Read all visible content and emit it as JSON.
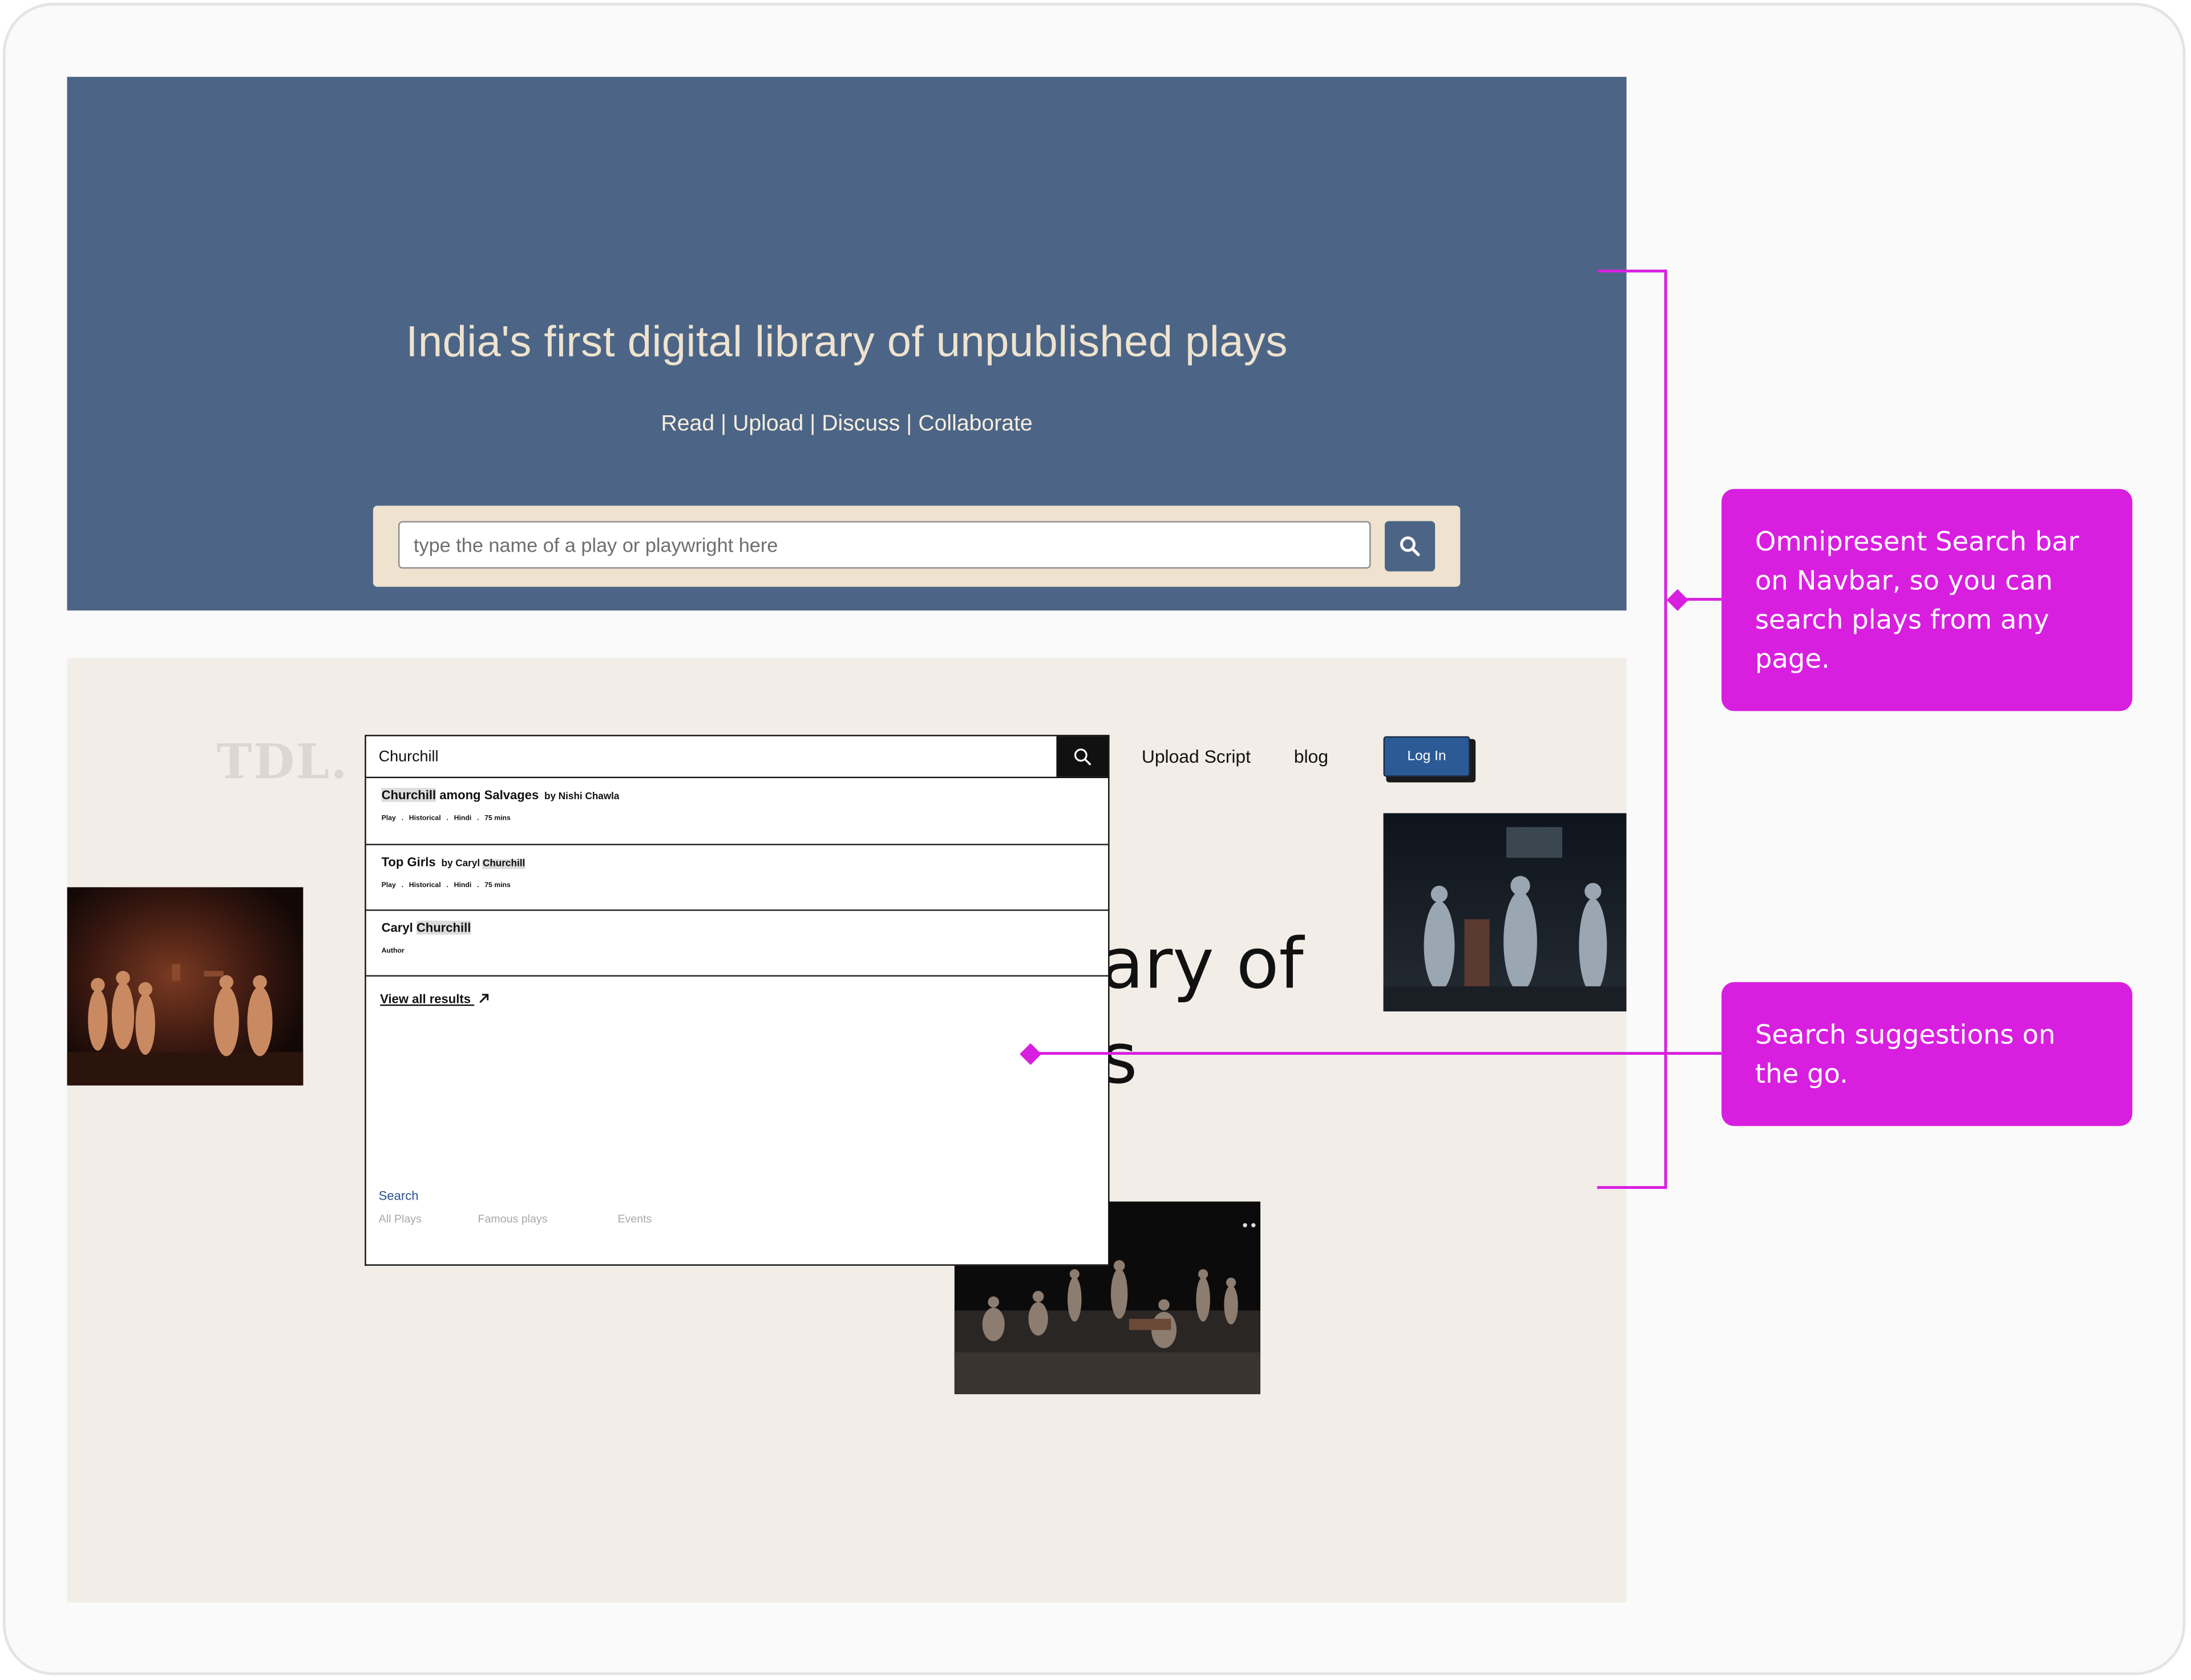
{
  "hero": {
    "title": "India's first digital library of unpublished plays",
    "subtitle": "Read | Upload | Discuss | Collaborate",
    "search_placeholder": "type the name of a play or playwright here",
    "bg_color": "#4c6586",
    "search_bg_color": "#efe3cf"
  },
  "navbar": {
    "logo": "TDL.",
    "search_value": "Churchill",
    "upload_label": "Upload Script",
    "blog_label": "blog",
    "login_label": "Log In"
  },
  "hero2": {
    "text_line1": "ary of",
    "text_line2": "s"
  },
  "suggestions": {
    "items": [
      {
        "title_highlight": "Churchill",
        "title_rest": " among Salvages",
        "by": "by Nishi Chawla",
        "meta": [
          "Play",
          ".",
          "Historical",
          ".",
          "Hindi",
          ".",
          "75 mins"
        ]
      },
      {
        "title": "Top Girls",
        "by_prefix": "by Caryl ",
        "by_highlight": "Churchill",
        "meta": [
          "Play",
          ".",
          "Historical",
          ".",
          "Hindi",
          ".",
          "75 mins"
        ]
      },
      {
        "title_prefix": "Caryl ",
        "title_highlight": "Churchill",
        "meta": [
          "Author"
        ]
      }
    ],
    "view_all": "View all results",
    "search_label": "Search",
    "tabs": [
      "All Plays",
      "Famous plays",
      "Events"
    ]
  },
  "annotations": {
    "navbar_search": "Omnipresent Search bar on Navbar, so you can search plays from any page.",
    "suggestions": "Search suggestions on the go.",
    "color": "#d81fe0"
  },
  "icons": {
    "hero_search": "search-icon",
    "navbar_search": "search-icon",
    "view_all_arrow": "arrow-up-right-icon"
  }
}
